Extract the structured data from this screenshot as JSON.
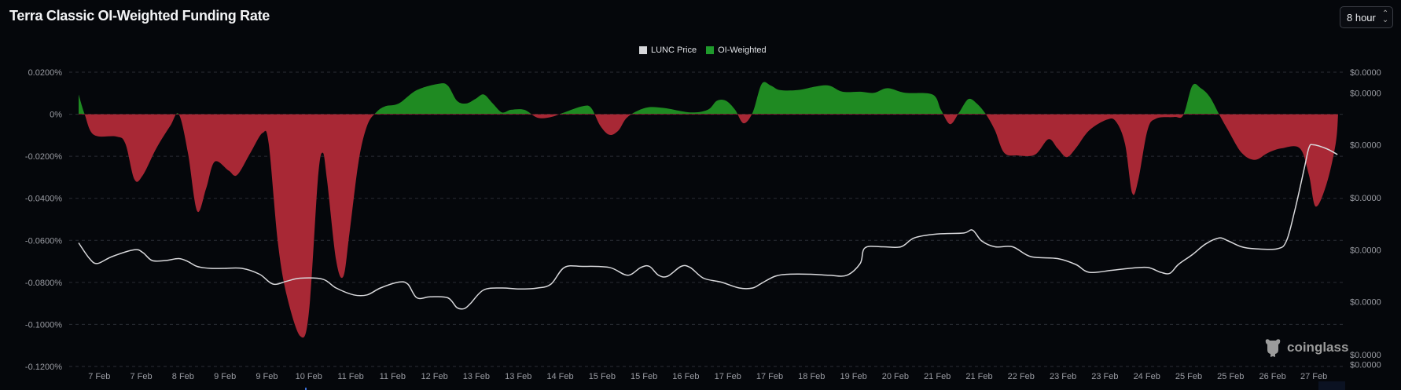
{
  "header": {
    "title": "Terra Classic OI-Weighted Funding Rate",
    "interval": "8 hour"
  },
  "legend": [
    {
      "label": "LUNC Price",
      "color": "#d6d7da"
    },
    {
      "label": "OI-Weighted",
      "color": "#1f9a2c"
    }
  ],
  "watermark": "coinglass",
  "chart_data": {
    "type": "area",
    "title": "Terra Classic OI-Weighted Funding Rate",
    "xlim": [
      6.61,
      27.35
    ],
    "x_ticks": [
      {
        "d": 6.95,
        "label": "7 Feb"
      },
      {
        "d": 7.64,
        "label": "7 Feb"
      },
      {
        "d": 8.33,
        "label": "8 Feb"
      },
      {
        "d": 9.02,
        "label": "9 Feb"
      },
      {
        "d": 9.71,
        "label": "9 Feb"
      },
      {
        "d": 10.4,
        "label": "10 Feb"
      },
      {
        "d": 11.09,
        "label": "11 Feb"
      },
      {
        "d": 11.78,
        "label": "11 Feb"
      },
      {
        "d": 12.47,
        "label": "12 Feb"
      },
      {
        "d": 13.16,
        "label": "13 Feb"
      },
      {
        "d": 13.85,
        "label": "13 Feb"
      },
      {
        "d": 14.54,
        "label": "14 Feb"
      },
      {
        "d": 15.23,
        "label": "15 Feb"
      },
      {
        "d": 15.92,
        "label": "15 Feb"
      },
      {
        "d": 16.61,
        "label": "16 Feb"
      },
      {
        "d": 17.3,
        "label": "17 Feb"
      },
      {
        "d": 17.99,
        "label": "17 Feb"
      },
      {
        "d": 18.68,
        "label": "18 Feb"
      },
      {
        "d": 19.37,
        "label": "19 Feb"
      },
      {
        "d": 20.06,
        "label": "20 Feb"
      },
      {
        "d": 20.75,
        "label": "21 Feb"
      },
      {
        "d": 21.44,
        "label": "21 Feb"
      },
      {
        "d": 22.13,
        "label": "22 Feb"
      },
      {
        "d": 22.82,
        "label": "23 Feb"
      },
      {
        "d": 23.51,
        "label": "23 Feb"
      },
      {
        "d": 24.2,
        "label": "24 Feb"
      },
      {
        "d": 24.89,
        "label": "25 Feb"
      },
      {
        "d": 25.58,
        "label": "25 Feb"
      },
      {
        "d": 26.27,
        "label": "26 Feb"
      },
      {
        "d": 26.95,
        "label": "27 Feb"
      }
    ],
    "left_axis": {
      "ylim": [
        -0.12,
        0.02
      ],
      "ticks": [
        {
          "v": 0.02,
          "label": "0.0200%"
        },
        {
          "v": 0,
          "label": "0%"
        },
        {
          "v": -0.02,
          "label": "-0.0200%"
        },
        {
          "v": -0.04,
          "label": "-0.0400%"
        },
        {
          "v": -0.06,
          "label": "-0.0600%"
        },
        {
          "v": -0.08,
          "label": "-0.0800%"
        },
        {
          "v": -0.1,
          "label": "-0.1000%"
        },
        {
          "v": -0.12,
          "label": "-0.1200%"
        }
      ]
    },
    "right_axis": {
      "ylim": [
        4e-05,
        7e-05
      ],
      "ticks": [
        {
          "v": 7e-05,
          "label": "$0.0000"
        },
        {
          "v": 6.79e-05,
          "label": "$0.0000"
        },
        {
          "v": 6.26e-05,
          "label": "$0.0000"
        },
        {
          "v": 5.72e-05,
          "label": "$0.0000"
        },
        {
          "v": 5.19e-05,
          "label": "$0.0000"
        },
        {
          "v": 4.66e-05,
          "label": "$0.0000"
        },
        {
          "v": 4.12e-05,
          "label": "$0.0000"
        },
        {
          "v": 4.02e-05,
          "label": "$0.0000"
        }
      ]
    },
    "series": [
      {
        "name": "OI-Weighted",
        "unit": "%",
        "positive_color": "#1f8a22",
        "negative_color": "#a82835",
        "points": [
          [
            6.61,
            0.0094
          ],
          [
            6.71,
            0
          ],
          [
            6.86,
            -0.0098
          ],
          [
            7.23,
            -0.0106
          ],
          [
            7.38,
            -0.014
          ],
          [
            7.53,
            -0.0311
          ],
          [
            7.67,
            -0.0289
          ],
          [
            7.89,
            -0.0162
          ],
          [
            8.12,
            -0.0055
          ],
          [
            8.26,
            0
          ],
          [
            8.41,
            -0.0183
          ],
          [
            8.56,
            -0.046
          ],
          [
            8.71,
            -0.0353
          ],
          [
            8.85,
            -0.0226
          ],
          [
            9.08,
            -0.0268
          ],
          [
            9.22,
            -0.0289
          ],
          [
            9.44,
            -0.0183
          ],
          [
            9.64,
            -0.0089
          ],
          [
            9.74,
            -0.014
          ],
          [
            9.89,
            -0.0609
          ],
          [
            10.04,
            -0.0865
          ],
          [
            10.26,
            -0.1056
          ],
          [
            10.4,
            -0.095
          ],
          [
            10.55,
            -0.0311
          ],
          [
            10.63,
            -0.0183
          ],
          [
            10.7,
            -0.0311
          ],
          [
            10.85,
            -0.0694
          ],
          [
            10.97,
            -0.0771
          ],
          [
            11.07,
            -0.0566
          ],
          [
            11.22,
            -0.0226
          ],
          [
            11.36,
            -0.0055
          ],
          [
            11.51,
            0.0009
          ],
          [
            11.66,
            0.0038
          ],
          [
            11.88,
            0.0051
          ],
          [
            12.18,
            0.0115
          ],
          [
            12.54,
            0.0145
          ],
          [
            12.69,
            0.0136
          ],
          [
            12.84,
            0.0064
          ],
          [
            12.99,
            0.0051
          ],
          [
            13.14,
            0.0072
          ],
          [
            13.28,
            0.0094
          ],
          [
            13.43,
            0.0051
          ],
          [
            13.58,
            0.0009
          ],
          [
            13.73,
            0.0021
          ],
          [
            13.95,
            0.0021
          ],
          [
            14.17,
            -0.0017
          ],
          [
            14.39,
            -0.0013
          ],
          [
            14.61,
            0.0009
          ],
          [
            14.91,
            0.0038
          ],
          [
            15.05,
            0.003
          ],
          [
            15.2,
            -0.0055
          ],
          [
            15.35,
            -0.0098
          ],
          [
            15.5,
            -0.0077
          ],
          [
            15.65,
            -0.0013
          ],
          [
            15.94,
            0.003
          ],
          [
            16.24,
            0.003
          ],
          [
            16.68,
            0.0009
          ],
          [
            16.97,
            0.0021
          ],
          [
            17.12,
            0.0064
          ],
          [
            17.27,
            0.0064
          ],
          [
            17.42,
            0.0021
          ],
          [
            17.56,
            -0.0043
          ],
          [
            17.71,
            0.0009
          ],
          [
            17.86,
            0.0145
          ],
          [
            18.01,
            0.0136
          ],
          [
            18.16,
            0.0115
          ],
          [
            18.45,
            0.0115
          ],
          [
            18.75,
            0.0132
          ],
          [
            18.97,
            0.0136
          ],
          [
            19.19,
            0.0107
          ],
          [
            19.48,
            0.0107
          ],
          [
            19.71,
            0.0102
          ],
          [
            19.93,
            0.0124
          ],
          [
            20.22,
            0.0102
          ],
          [
            20.67,
            0.0094
          ],
          [
            20.81,
            0.0021
          ],
          [
            20.96,
            -0.0047
          ],
          [
            21.11,
            0.0009
          ],
          [
            21.26,
            0.0072
          ],
          [
            21.4,
            0.0051
          ],
          [
            21.55,
            0
          ],
          [
            21.7,
            -0.0077
          ],
          [
            21.85,
            -0.0183
          ],
          [
            22.07,
            -0.0196
          ],
          [
            22.36,
            -0.0192
          ],
          [
            22.58,
            -0.0119
          ],
          [
            22.73,
            -0.0162
          ],
          [
            22.88,
            -0.0204
          ],
          [
            23.03,
            -0.0162
          ],
          [
            23.25,
            -0.0077
          ],
          [
            23.54,
            -0.0026
          ],
          [
            23.69,
            -0.0034
          ],
          [
            23.84,
            -0.014
          ],
          [
            23.96,
            -0.0375
          ],
          [
            24.06,
            -0.0311
          ],
          [
            24.21,
            -0.0077
          ],
          [
            24.35,
            -0.0021
          ],
          [
            24.65,
            -0.0013
          ],
          [
            24.8,
            -0.0004
          ],
          [
            24.95,
            0.0136
          ],
          [
            25.09,
            0.0124
          ],
          [
            25.24,
            0.0081
          ],
          [
            25.39,
            0
          ],
          [
            25.54,
            -0.0077
          ],
          [
            25.76,
            -0.0183
          ],
          [
            25.98,
            -0.0217
          ],
          [
            26.2,
            -0.0183
          ],
          [
            26.42,
            -0.0162
          ],
          [
            26.72,
            -0.0162
          ],
          [
            26.87,
            -0.0289
          ],
          [
            26.98,
            -0.0439
          ],
          [
            27.16,
            -0.0332
          ],
          [
            27.31,
            -0.014
          ],
          [
            27.35,
            0
          ]
        ]
      },
      {
        "name": "LUNC Price",
        "unit": "USD",
        "color": "#d9d9dc",
        "points": [
          [
            6.61,
            5.26e-05
          ],
          [
            6.79,
            5.1e-05
          ],
          [
            6.92,
            5.05e-05
          ],
          [
            7.16,
            5.12e-05
          ],
          [
            7.53,
            5.19e-05
          ],
          [
            7.67,
            5.16e-05
          ],
          [
            7.82,
            5.08e-05
          ],
          [
            8.04,
            5.08e-05
          ],
          [
            8.26,
            5.1e-05
          ],
          [
            8.41,
            5.07e-05
          ],
          [
            8.56,
            5.02e-05
          ],
          [
            8.78,
            5e-05
          ],
          [
            9.0,
            5e-05
          ],
          [
            9.3,
            5e-05
          ],
          [
            9.59,
            4.94e-05
          ],
          [
            9.81,
            4.84e-05
          ],
          [
            10.04,
            4.87e-05
          ],
          [
            10.26,
            4.9e-05
          ],
          [
            10.63,
            4.89e-05
          ],
          [
            10.85,
            4.8e-05
          ],
          [
            11.14,
            4.73e-05
          ],
          [
            11.36,
            4.73e-05
          ],
          [
            11.58,
            4.8e-05
          ],
          [
            11.88,
            4.86e-05
          ],
          [
            12.03,
            4.84e-05
          ],
          [
            12.18,
            4.7e-05
          ],
          [
            12.4,
            4.71e-05
          ],
          [
            12.69,
            4.7e-05
          ],
          [
            12.84,
            4.6e-05
          ],
          [
            12.96,
            4.59e-05
          ],
          [
            13.06,
            4.64e-05
          ],
          [
            13.28,
            4.78e-05
          ],
          [
            13.58,
            4.8e-05
          ],
          [
            13.87,
            4.79e-05
          ],
          [
            14.17,
            4.8e-05
          ],
          [
            14.39,
            4.84e-05
          ],
          [
            14.61,
            5.01e-05
          ],
          [
            14.91,
            5.02e-05
          ],
          [
            15.35,
            5.01e-05
          ],
          [
            15.65,
            4.93e-05
          ],
          [
            15.87,
            5.01e-05
          ],
          [
            16.01,
            5.02e-05
          ],
          [
            16.16,
            4.93e-05
          ],
          [
            16.31,
            4.92e-05
          ],
          [
            16.53,
            5.02e-05
          ],
          [
            16.68,
            5.01e-05
          ],
          [
            16.9,
            4.9e-05
          ],
          [
            17.19,
            4.86e-05
          ],
          [
            17.49,
            4.8e-05
          ],
          [
            17.71,
            4.8e-05
          ],
          [
            17.86,
            4.85e-05
          ],
          [
            18.08,
            4.92e-05
          ],
          [
            18.3,
            4.94e-05
          ],
          [
            18.67,
            4.94e-05
          ],
          [
            18.97,
            4.93e-05
          ],
          [
            19.26,
            4.93e-05
          ],
          [
            19.48,
            5.05e-05
          ],
          [
            19.56,
            5.21e-05
          ],
          [
            19.85,
            5.22e-05
          ],
          [
            20.15,
            5.22e-05
          ],
          [
            20.37,
            5.31e-05
          ],
          [
            20.74,
            5.35e-05
          ],
          [
            21.18,
            5.36e-05
          ],
          [
            21.33,
            5.39e-05
          ],
          [
            21.48,
            5.28e-05
          ],
          [
            21.7,
            5.22e-05
          ],
          [
            21.99,
            5.22e-05
          ],
          [
            22.29,
            5.12e-05
          ],
          [
            22.73,
            5.1e-05
          ],
          [
            23.03,
            5.04e-05
          ],
          [
            23.25,
            4.96e-05
          ],
          [
            23.62,
            4.98e-05
          ],
          [
            23.91,
            5e-05
          ],
          [
            24.21,
            5.01e-05
          ],
          [
            24.43,
            4.96e-05
          ],
          [
            24.58,
            4.95e-05
          ],
          [
            24.72,
            5.04e-05
          ],
          [
            24.95,
            5.14e-05
          ],
          [
            25.17,
            5.25e-05
          ],
          [
            25.39,
            5.31e-05
          ],
          [
            25.54,
            5.28e-05
          ],
          [
            25.76,
            5.22e-05
          ],
          [
            25.98,
            5.2e-05
          ],
          [
            26.35,
            5.2e-05
          ],
          [
            26.5,
            5.28e-05
          ],
          [
            26.64,
            5.6e-05
          ],
          [
            26.79,
            6.01e-05
          ],
          [
            26.87,
            6.23e-05
          ],
          [
            26.94,
            6.26e-05
          ],
          [
            27.16,
            6.22e-05
          ],
          [
            27.34,
            6.16e-05
          ]
        ]
      }
    ],
    "grid": true,
    "legend_position": "top-center"
  }
}
